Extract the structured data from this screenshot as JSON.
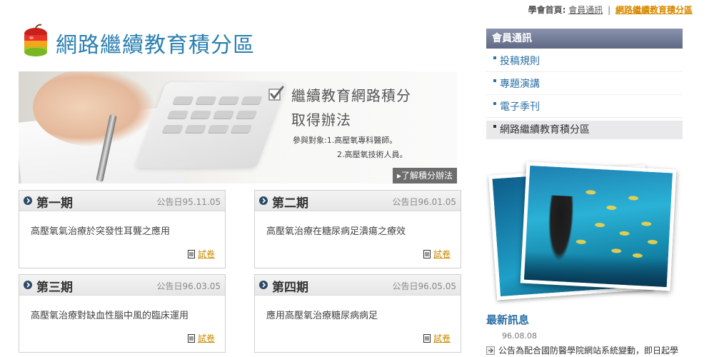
{
  "breadcrumb": {
    "prefix": "學會首頁:",
    "items": [
      "會員通訊",
      "網路繼續教育積分區"
    ],
    "separator": "|"
  },
  "page": {
    "title": "網路繼續教育積分區"
  },
  "banner": {
    "title_line1": "繼續教育網路積分",
    "title_line2": "取得辦法",
    "target_line1": "參與對象:1.高壓氧專科醫師。",
    "target_line2": "2.高壓氧技術人員。",
    "more_button": "了解積分辦法"
  },
  "periods": [
    {
      "name": "第一期",
      "announce": "公告日95.11.05",
      "topic": "高壓氧氣治療於突發性耳聾之應用",
      "exam_label": "試卷"
    },
    {
      "name": "第二期",
      "announce": "公告日96.01.05",
      "topic": "高壓氧治療在糖尿病足潰瘍之療效",
      "exam_label": "試卷"
    },
    {
      "name": "第三期",
      "announce": "公告日96.03.05",
      "topic": "高壓氧治療對缺血性腦中風的臨床運用",
      "exam_label": "試卷"
    },
    {
      "name": "第四期",
      "announce": "公告日96.05.05",
      "topic": "應用高壓氧治療糖尿病病足",
      "exam_label": "試卷"
    }
  ],
  "sidebar": {
    "header": "會員通訊",
    "items": [
      {
        "label": "投稿規則"
      },
      {
        "label": "專題演講"
      },
      {
        "label": "電子季刊"
      },
      {
        "label": "網路繼續教育積分區"
      }
    ]
  },
  "news": {
    "title": "最新訊息",
    "date": "96.08.08",
    "item": "公告為配合國防醫學院網站系統變動，即日起學"
  },
  "colors": {
    "title_blue": "#2a7fb0",
    "link_orange": "#c98a00",
    "sidebar_header": "#6f7893"
  }
}
